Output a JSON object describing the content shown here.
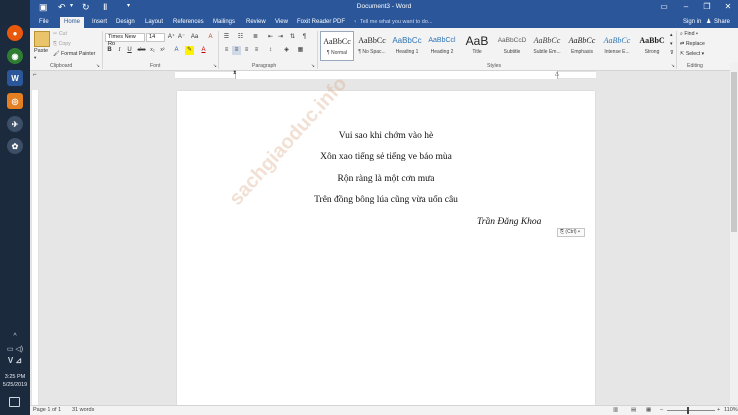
{
  "taskbar": {
    "time": "3:25 PM",
    "date": "5/25/2019"
  },
  "window": {
    "title": "Document3 - Word"
  },
  "tabs": [
    "File",
    "Home",
    "Insert",
    "Design",
    "Layout",
    "References",
    "Mailings",
    "Review",
    "View",
    "Foxit Reader PDF"
  ],
  "tell_me": "Tell me what you want to do...",
  "account": {
    "sign_in": "Sign in",
    "share": "Share"
  },
  "clipboard": {
    "paste": "Paste",
    "cut": "Cut",
    "copy": "Copy",
    "format_painter": "Format Painter",
    "label": "Clipboard"
  },
  "font": {
    "name": "Times New Ro",
    "size": "14",
    "label": "Font"
  },
  "paragraph": {
    "label": "Paragraph"
  },
  "styles": {
    "label": "Styles",
    "items": [
      {
        "preview": "AaBbCc",
        "name": "¶ Normal"
      },
      {
        "preview": "AaBbCc",
        "name": "¶ No Spac..."
      },
      {
        "preview": "AaBbCc",
        "name": "Heading 1"
      },
      {
        "preview": "AaBbCcl",
        "name": "Heading 2"
      },
      {
        "preview": "AaB",
        "name": "Title"
      },
      {
        "preview": "AaBbCcD",
        "name": "Subtitle"
      },
      {
        "preview": "AaBbCc",
        "name": "Subtle Em..."
      },
      {
        "preview": "AaBbCc",
        "name": "Emphasis"
      },
      {
        "preview": "AaBbCc",
        "name": "Intense E..."
      },
      {
        "preview": "AaBbC",
        "name": "Strong"
      }
    ]
  },
  "editing": {
    "find": "Find",
    "replace": "Replace",
    "select": "Select",
    "label": "Editing"
  },
  "document": {
    "lines": [
      "Vui sao khi chớm vào hè",
      "Xôn xao tiếng sẻ tiếng ve báo mùa",
      "Rộn ràng là một cơn mưa",
      "Trên đồng bông lúa cũng vừa uốn câu"
    ],
    "author": "Trần Đăng Khoa",
    "paste_option": "(Ctrl)",
    "watermark": "sachgiaoduc.info"
  },
  "status": {
    "page": "Page 1 of 1",
    "words": "31 words",
    "zoom": "110%"
  },
  "colors": {
    "accent": "#2b579a",
    "taskbar": "#1b2a3d"
  }
}
